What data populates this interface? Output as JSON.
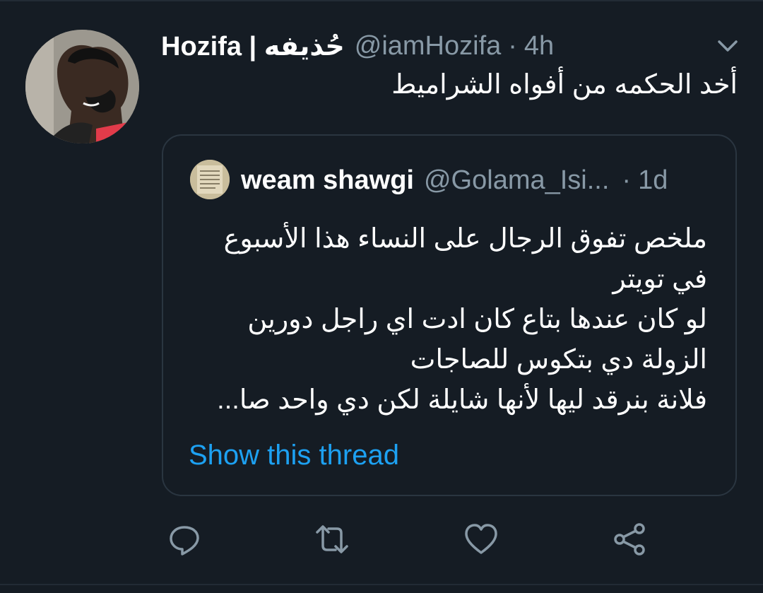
{
  "tweet": {
    "display_name": "Hozifa | حُذيفه",
    "handle": "@iamHozifa",
    "separator": "·",
    "time": "4h",
    "text": "أخد الحكمه من أفواه الشراميط"
  },
  "quoted_tweet": {
    "display_name": "weam shawgi",
    "handle": "@Golama_Isi...",
    "separator": "·",
    "time": "1d",
    "lines": [
      "ملخص تفوق الرجال على النساء هذا الأسبوع",
      "في تويتر",
      "لو كان عندها بتاع كان ادت اي راجل دورين",
      "الزولة دي بتكوس للصاجات",
      "فلانة بنرقد ليها لأنها شايلة لكن دي واحد صا..."
    ],
    "show_thread": "Show this thread"
  },
  "icons": {
    "menu": "chevron-down-icon",
    "reply": "reply-icon",
    "retweet": "retweet-icon",
    "like": "heart-icon",
    "share": "share-icon"
  },
  "colors": {
    "background": "#151c24",
    "secondary_text": "#8899a6",
    "link": "#1da1f2",
    "border": "#2a3540"
  }
}
